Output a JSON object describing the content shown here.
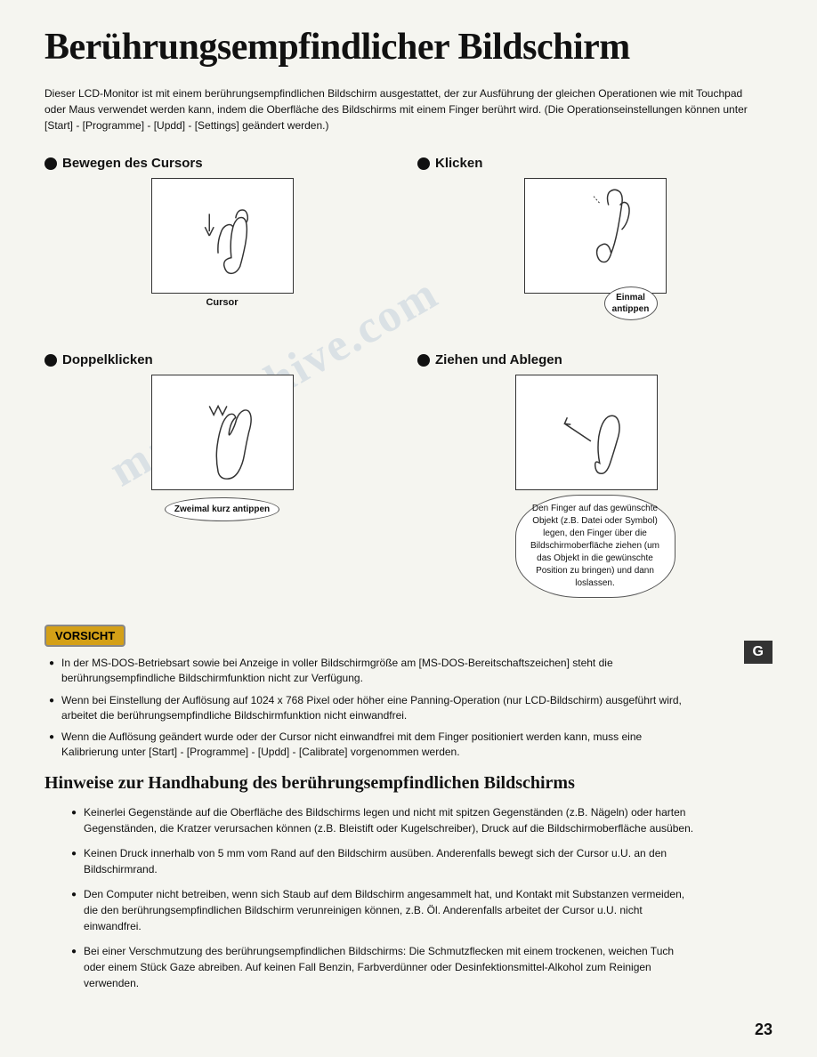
{
  "page": {
    "title": "Berührungsempfindlicher Bildschirm",
    "page_number": "23",
    "watermark": "manualshive.com",
    "intro": "Dieser LCD-Monitor ist mit einem berührungsempfindlichen Bildschirm ausgestattet, der zur Ausführung der gleichen Operationen wie mit Touchpad oder Maus verwendet werden kann, indem die Oberfläche des Bildschirms mit einem Finger berührt wird. (Die Operationseinstellungen können unter [Start] - [Programme] - [Updd] - [Settings] geändert werden.)",
    "sections": [
      {
        "id": "bewegen",
        "title": "Bewegen des Cursors",
        "label": "Cursor"
      },
      {
        "id": "klicken",
        "title": "Klicken",
        "bubble": "Einmal antippen"
      },
      {
        "id": "doppelklicken",
        "title": "Doppelklicken",
        "bubble": "Zweimal kurz antippen"
      },
      {
        "id": "ziehen",
        "title": "Ziehen und Ablegen",
        "bubble": "Den Finger auf das gewünschte Objekt (z.B. Datei oder Symbol) legen, den Finger über die Bildschirmoberfläche ziehen (um das Objekt in die gewünschte Position zu bringen) und dann loslassen."
      }
    ],
    "vorsicht": {
      "badge": "VORSICHT",
      "items": [
        "In der MS-DOS-Betriebsart sowie bei Anzeige in voller Bildschirmgröße am [MS-DOS-Bereitschaftszeichen] steht die berührungsempfindliche Bildschirmfunktion nicht zur Verfügung.",
        "Wenn bei Einstellung der Auflösung auf 1024 x 768 Pixel oder höher eine Panning-Operation (nur LCD-Bildschirm) ausgeführt wird, arbeitet die berührungsempfindliche Bildschirmfunktion nicht einwandfrei.",
        "Wenn die Auflösung geändert wurde oder der Cursor nicht einwandfrei mit dem Finger positioniert werden kann, muss eine Kalibrierung unter [Start] - [Programme] - [Updd] - [Calibrate] vorgenommen werden."
      ]
    },
    "g_badge": "G",
    "hinweise": {
      "title": "Hinweise zur Handhabung des berührungsempfindlichen Bildschirms",
      "items": [
        "Keinerlei Gegenstände auf die Oberfläche des Bildschirms legen und nicht mit spitzen Gegenständen (z.B. Nägeln) oder harten Gegenständen, die Kratzer verursachen können (z.B. Bleistift oder Kugelschreiber), Druck auf die Bildschirmoberfläche ausüben.",
        "Keinen Druck innerhalb von 5 mm vom Rand auf den Bildschirm ausüben. Anderenfalls bewegt sich der Cursor u.U. an den Bildschirmrand.",
        "Den Computer nicht betreiben, wenn sich Staub auf dem Bildschirm angesammelt hat, und Kontakt mit Substanzen vermeiden, die den berührungsempfindlichen Bildschirm verunreinigen können, z.B. Öl. Anderenfalls arbeitet der Cursor u.U. nicht einwandfrei.",
        "Bei einer Verschmutzung des berührungsempfindlichen Bildschirms: Die Schmutzflecken mit einem trockenen, weichen Tuch oder einem Stück Gaze abreiben. Auf keinen Fall Benzin, Farbverdünner oder Desinfektionsmittel-Alkohol zum Reinigen verwenden."
      ]
    }
  }
}
